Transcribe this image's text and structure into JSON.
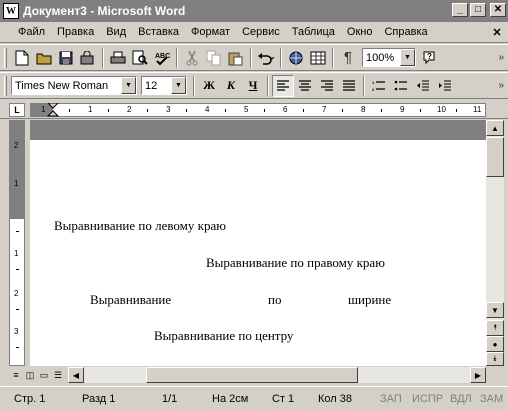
{
  "window": {
    "title": "Документ3 - Microsoft Word",
    "icon_label": "W",
    "controls": {
      "minimize": "_",
      "maximize": "□",
      "close": "✕"
    }
  },
  "menu": {
    "items": [
      "Файл",
      "Правка",
      "Вид",
      "Вставка",
      "Формат",
      "Сервис",
      "Таблица",
      "Окно",
      "Справка"
    ],
    "close_doc": "✕"
  },
  "toolbar": {
    "zoom": "100%",
    "icons": [
      "new-icon",
      "open-icon",
      "save-icon",
      "permission-icon",
      "print-icon",
      "print-preview-icon",
      "spelling-icon",
      "cut-icon",
      "copy-icon",
      "paste-icon",
      "undo-icon",
      "hyperlink-icon",
      "tables-borders-icon",
      "show-hide-icon",
      "zoom-icon",
      "help-icon"
    ]
  },
  "formatting": {
    "font": "Times New Roman",
    "size": "12",
    "bold": "Ж",
    "italic": "К",
    "underline": "Ч"
  },
  "ruler": {
    "corner": "L",
    "numbers": [
      "1",
      "1",
      "2",
      "3",
      "4",
      "5",
      "6",
      "7",
      "8",
      "9",
      "10",
      "11"
    ],
    "vnumbers": [
      "2",
      "1",
      "1",
      "2",
      "3"
    ]
  },
  "document": {
    "paragraphs": {
      "left": "Выравнивание по левому краю",
      "right": "Выравнивание по правому краю",
      "justify_1": "Выравнивание",
      "justify_2": "по",
      "justify_3": "ширине",
      "center": "Выравнивание по центру"
    }
  },
  "status": {
    "page": "Стр. 1",
    "section": "Разд 1",
    "pages": "1/1",
    "at": "На 2см",
    "line": "Ст 1",
    "col": "Кол 38",
    "rec": "ЗАП",
    "trk": "ИСПР",
    "ext": "ВДЛ",
    "ovr": "ЗАМ"
  }
}
